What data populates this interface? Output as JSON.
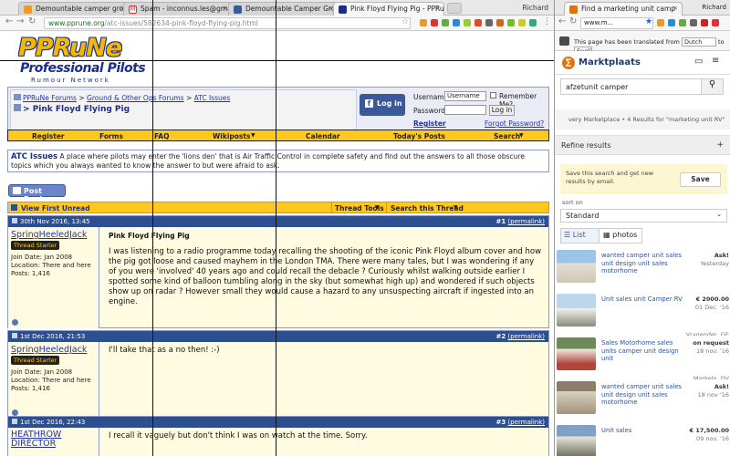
{
  "left_browser": {
    "tabs": [
      "Demountable camper group",
      "Spam - inconnus.les@gmail.c...",
      "Demountable Camper Group",
      "Pink Floyd Flying Pig - PPRu..."
    ],
    "user": "Richard",
    "url_domain": "www.pprune.org",
    "url_path": "/atc-issues/582634-pink-floyd-flying-pig.html"
  },
  "site": {
    "logo_top": "PPRuNe",
    "logo_mid": "Professional Pilots",
    "logo_bottom": "Rumour Network"
  },
  "breadcrumb": {
    "items": [
      "PPRuNe Forums",
      "Ground & Other Ops Forums",
      "ATC Issues"
    ],
    "sep": ">",
    "thread": "Pink Floyd Flying Pig"
  },
  "login": {
    "fb": "Log in",
    "username_label": "Username",
    "username_value": "Username",
    "password_label": "Password",
    "remember": "Remember Me?",
    "login_btn": "Log in",
    "register": "Register",
    "forgot": "Forgot Password?"
  },
  "navbar": [
    "Register",
    "Forms",
    "FAQ",
    "Wikiposts",
    "Calendar",
    "Today's Posts",
    "Search"
  ],
  "forum_desc": {
    "title": "ATC Issues",
    "text": "A place where pilots may enter the 'lions den' that is Air Traffic Control in complete safety and find out the answers to all those obscure topics which you always wanted to know the answer to but were afraid to ask."
  },
  "post_reply": "Post Reply",
  "thread_bar": {
    "view_first_unread": "View First Unread",
    "thread_tools": "Thread Tools",
    "search_thread": "Search this Thread"
  },
  "posts": [
    {
      "date": "30th Nov 2016, 13:45",
      "num": "#1",
      "permalink": "(permalink)",
      "user": "SpringHeeledJack",
      "badge": "Thread Starter",
      "join": "Join Date: Jan 2008",
      "location": "Location: There and here",
      "posts": "Posts: 1,416",
      "title": "Pink Floyd Flying Pig",
      "text": "I was listening to a radio programme today recalling the shooting of the iconic Pink Floyd album cover and how the pig got loose and caused mayhem in the London TMA. There were many tales, but I was wondering if any of you were 'involved' 40 years ago and could recall the debacle ? Curiously whilst walking outside earlier I spotted some kind of balloon tumbling along in the sky (but somewhat high up) and wondered if such objects show up on radar ? However small they would cause a hazard to any unsuspecting aircraft if ingested into an engine."
    },
    {
      "date": "1st Dec 2016, 21:53",
      "num": "#2",
      "permalink": "(permalink)",
      "user": "SpringHeeledJack",
      "badge": "Thread Starter",
      "join": "Join Date: Jan 2008",
      "location": "Location: There and here",
      "posts": "Posts: 1,416",
      "title": "",
      "text": "I'll take that as a no then! :-)"
    },
    {
      "date": "1st Dec 2016, 22:43",
      "num": "#3",
      "permalink": "(permalink)",
      "user": "HEATHROW DIRECTOR",
      "badge": "",
      "join": "",
      "location": "",
      "posts": "",
      "title": "",
      "text": "I recall it vaguely but don't think I was on watch at the time. Sorry."
    }
  ],
  "right_browser": {
    "tab": "Find a marketing unit camp",
    "user": "Richard",
    "url": "www.m...",
    "translate_text": "This page has been translated from",
    "from_lang": "Dutch",
    "to_label": "to",
    "to_lang": "English"
  },
  "marktplaats": {
    "name": "Marktplaats",
    "search_value": "afzetunit camper",
    "crumb": "very Marketplace  •  4 Results for \"marketing unit RV\"",
    "refine": "Refine results",
    "save_text": "Save this search and get new results by email.",
    "save_btn": "Save",
    "sort_label": "sort on",
    "sort_value": "Standard",
    "view_list": "List",
    "view_photos": "photos",
    "listings": [
      {
        "title": "wanted camper unit sales unit design unit sales motorhome",
        "price": "Ask!",
        "date": "Yesterday",
        "location": ""
      },
      {
        "title": "Unit sales unit Camper RV",
        "price": "€ 2000.00",
        "date": "01 Dec. '16",
        "location": "Vragender, GE"
      },
      {
        "title": "Sales Motorhome sales units camper unit design unit",
        "price": "on request",
        "date": "18 nov. '16",
        "location": "Markelo, OV"
      },
      {
        "title": "wanted camper unit sales unit design unit sales motorhome",
        "price": "Ask!",
        "date": "18 nov '16",
        "location": ""
      },
      {
        "title": "Unit sales",
        "price": "€ 17,500.00",
        "date": "09 nov. '16",
        "location": ""
      }
    ]
  }
}
